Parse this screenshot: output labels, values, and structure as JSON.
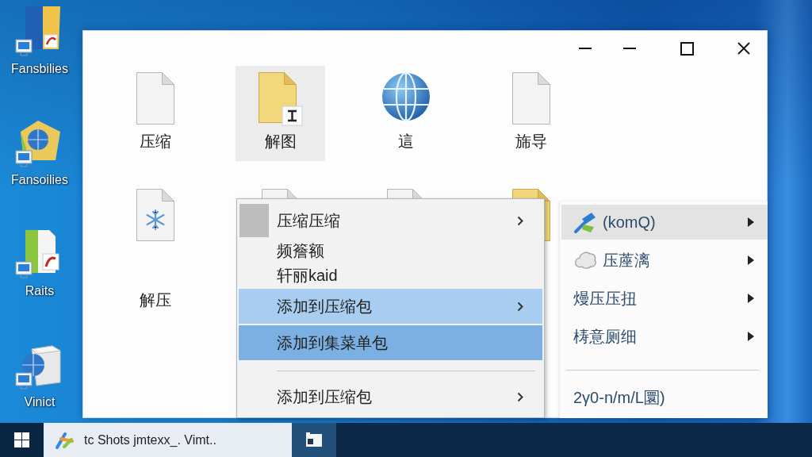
{
  "desktop_icons": [
    {
      "label": "Fansbilies"
    },
    {
      "label": "Fansoilies"
    },
    {
      "label": "Raits"
    },
    {
      "label": "Vinict"
    }
  ],
  "window": {
    "controls": [
      {
        "kind": "minimize"
      },
      {
        "kind": "minimize"
      },
      {
        "kind": "maximize"
      },
      {
        "kind": "close"
      }
    ],
    "files": [
      {
        "kind": "document",
        "label": "压缩",
        "selected": false
      },
      {
        "kind": "folder-shortcut",
        "label": "解图",
        "selected": true
      },
      {
        "kind": "globe",
        "label": "這",
        "selected": false
      },
      {
        "kind": "document",
        "label": "旆导",
        "selected": false
      },
      {
        "kind": "snowflake-document",
        "label": "解压",
        "selected": false
      },
      {
        "kind": "document",
        "selected": false
      },
      {
        "kind": "document",
        "selected": false
      },
      {
        "kind": "folder",
        "selected": false
      }
    ]
  },
  "context_menu": {
    "items": [
      {
        "kind": "item",
        "label": "压缩压缩",
        "has_icon": true,
        "has_submenu": true,
        "hovered": false,
        "selected": false
      },
      {
        "kind": "item",
        "label": "频簷额",
        "has_icon": false,
        "has_submenu": false,
        "hovered": false,
        "selected": false
      },
      {
        "kind": "item",
        "label": "轩丽kaid",
        "has_icon": false,
        "has_submenu": false,
        "hovered": false,
        "selected": false
      },
      {
        "kind": "item",
        "label": "添加到压缩包",
        "has_icon": false,
        "has_submenu": true,
        "hovered": true,
        "selected": false
      },
      {
        "kind": "item",
        "label": "添加到集菜单包",
        "has_icon": false,
        "has_submenu": false,
        "hovered": false,
        "selected": true
      },
      {
        "kind": "separator"
      },
      {
        "kind": "item",
        "label": "添加到压缩包",
        "has_icon": false,
        "has_submenu": true,
        "hovered": false,
        "selected": false
      }
    ]
  },
  "submenu": {
    "items": [
      {
        "kind": "item",
        "label": "(komQ)",
        "has_icon": true,
        "has_submenu": true,
        "hovered": true
      },
      {
        "kind": "item",
        "label": "压蓙漓",
        "has_icon": true,
        "has_submenu": true,
        "hovered": false
      },
      {
        "kind": "item",
        "label": "熳压压扭",
        "has_icon": false,
        "has_submenu": true,
        "hovered": false
      },
      {
        "kind": "item",
        "label": "梼意厕细",
        "has_icon": false,
        "has_submenu": true,
        "hovered": false
      },
      {
        "kind": "separator"
      },
      {
        "kind": "item",
        "label": "2γ0-n/m/L圜)",
        "has_icon": false,
        "has_submenu": false,
        "hovered": false
      }
    ]
  },
  "taskbar": {
    "apps": [
      {
        "label": "tc Shots jmtexx_. Vimt..",
        "active": true
      },
      {
        "active": false
      }
    ]
  }
}
